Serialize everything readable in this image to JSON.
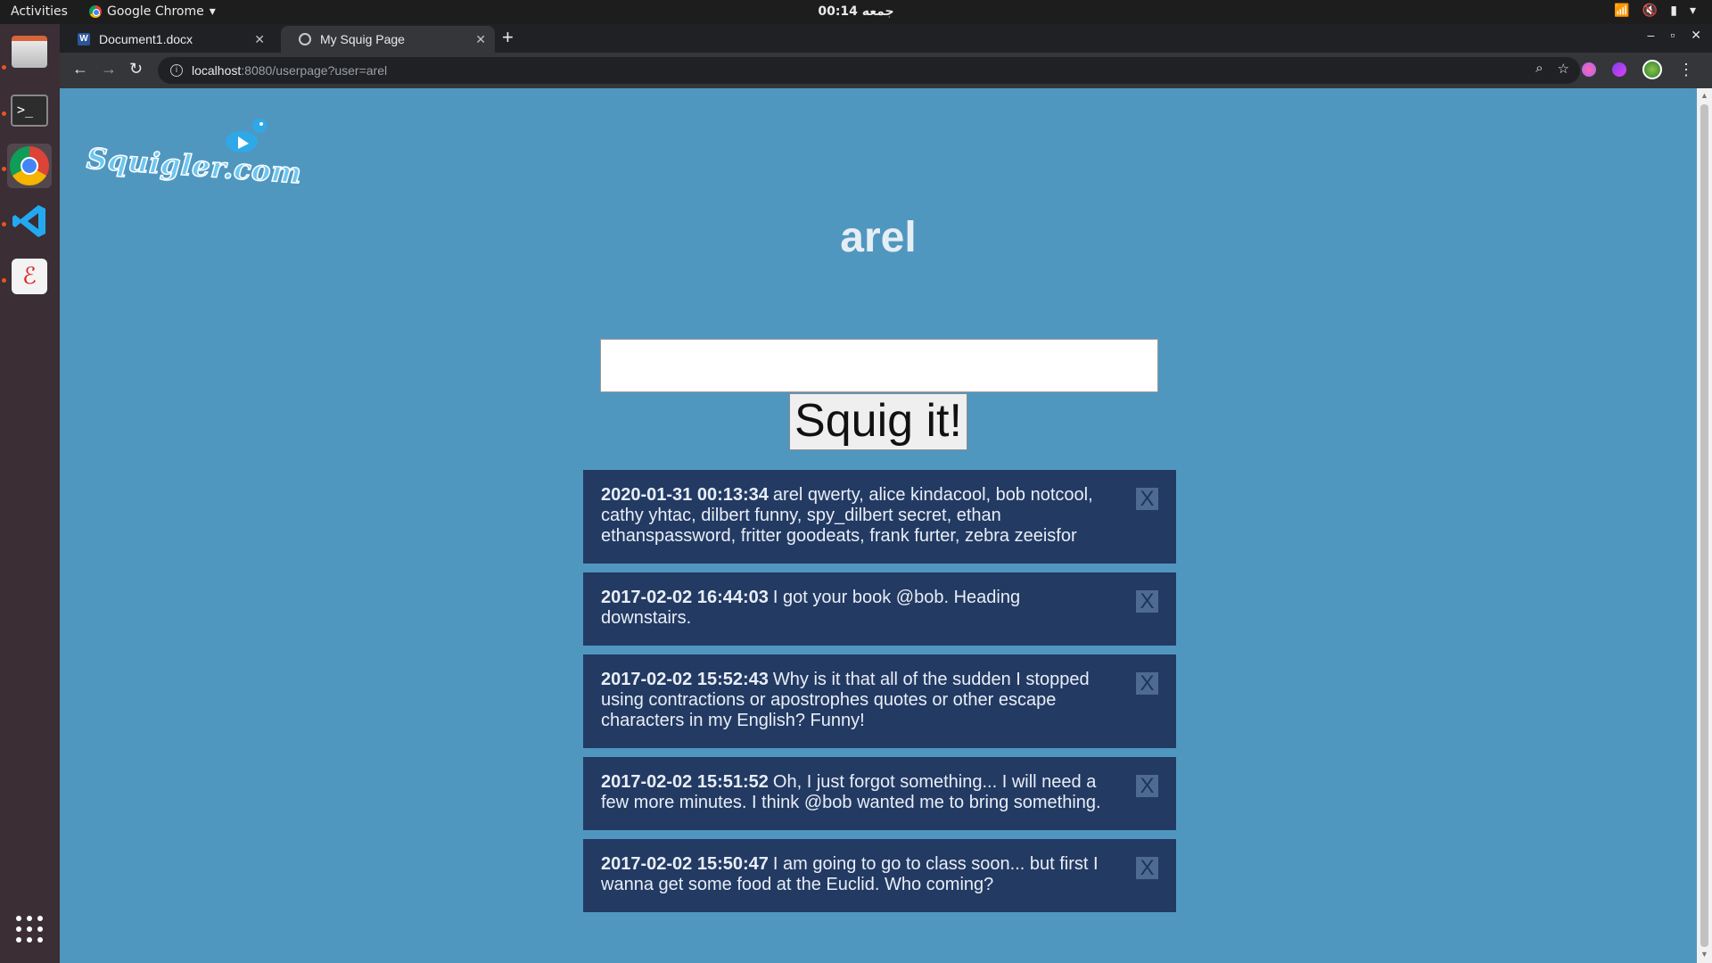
{
  "os": {
    "activities": "Activities",
    "app_menu": "Google Chrome",
    "clock": "00:14 جمعه"
  },
  "browser": {
    "tabs": [
      {
        "title": "Document1.docx",
        "favicon": "word-icon"
      },
      {
        "title": "My Squig Page",
        "favicon": "globe-icon"
      }
    ],
    "url_host": "localhost",
    "url_rest": ":8080/userpage?user=arel"
  },
  "page": {
    "logo_text": "Squigler.com",
    "username": "arel",
    "squig_input": {
      "value": "",
      "placeholder": ""
    },
    "squig_button": "Squig it!",
    "delete_label": "X",
    "posts": [
      {
        "timestamp": "2020-01-31 00:13:34",
        "text": "arel qwerty, alice kindacool, bob notcool, cathy yhtac, dilbert funny, spy_dilbert secret, ethan ethanspassword, fritter goodeats, frank furter, zebra zeeisfor"
      },
      {
        "timestamp": "2017-02-02 16:44:03",
        "text": "I got your book @bob. Heading downstairs."
      },
      {
        "timestamp": "2017-02-02 15:52:43",
        "text": "Why is it that all of the sudden I stopped using contractions or apostrophes quotes or other escape characters in my English? Funny!"
      },
      {
        "timestamp": "2017-02-02 15:51:52",
        "text": "Oh, I just forgot something... I will need a few more minutes. I think @bob wanted me to bring something."
      },
      {
        "timestamp": "2017-02-02 15:50:47",
        "text": "I am going to go to class soon... but first I wanna get some food at the Euclid. Who coming?"
      }
    ]
  },
  "colors": {
    "page_bg": "#5097c0",
    "post_bg": "#233a63",
    "delete_bg": "#4e6a90"
  }
}
